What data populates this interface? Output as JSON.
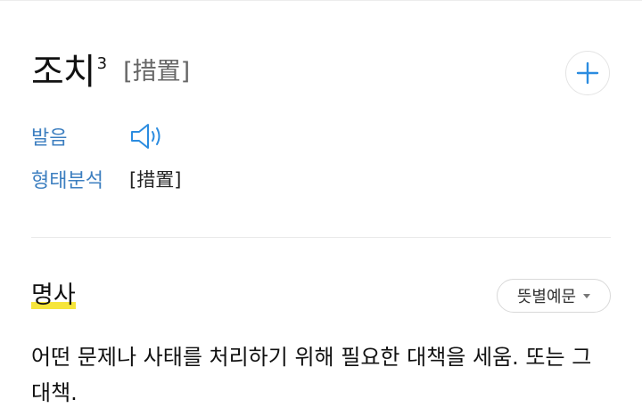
{
  "entry": {
    "headword": "조치",
    "homonym_number": "3",
    "hanja": "[措置]",
    "add_button_symbol": "+",
    "pronunciation": {
      "label": "발음",
      "speaker_icon": "speaker-icon"
    },
    "morphology": {
      "label": "형태분석",
      "value": "[措置]"
    }
  },
  "sense": {
    "part_of_speech": "명사",
    "filter_dropdown": {
      "selected": "뜻별예문",
      "icon": "caret-down-icon"
    },
    "definition": "어떤 문제나 사태를 처리하기 위해 필요한 대책을 세움. 또는 그 대책."
  },
  "colors": {
    "label_blue": "#3d7fc0",
    "accent_blue": "#2b8ce0",
    "highlight_yellow": "#f6e53b"
  }
}
